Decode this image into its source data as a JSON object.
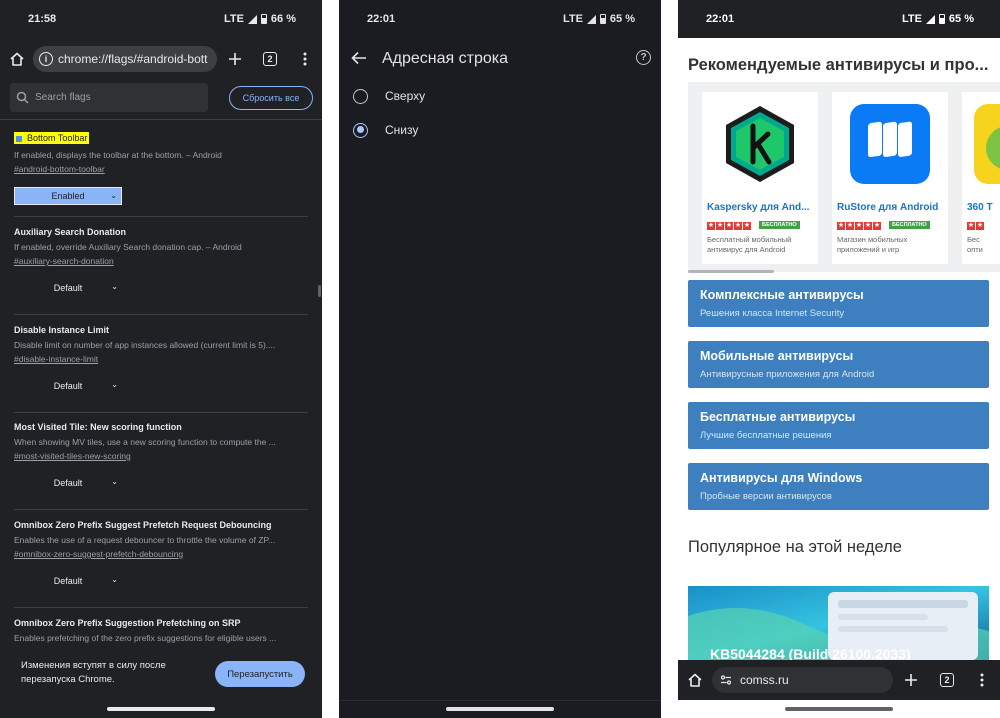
{
  "panel1": {
    "status": {
      "time": "21:58",
      "network": "LTE",
      "battery": "66 %"
    },
    "url": "chrome://flags/#android-bott",
    "tab_count": "2",
    "search_placeholder": "Search flags",
    "reset_label": "Сбросить все",
    "flags": [
      {
        "title": "Bottom Toolbar",
        "desc": "If enabled, displays the toolbar at the bottom. – Android",
        "link": "#android-bottom-toolbar",
        "value": "Enabled"
      },
      {
        "title": "Auxiliary Search Donation",
        "desc": "If enabled, override Auxiliary Search donation cap. – Android",
        "link": "#auxiliary-search-donation",
        "value": "Default"
      },
      {
        "title": "Disable Instance Limit",
        "desc": "Disable limit on number of app instances allowed (current limit is 5)....",
        "link": "#disable-instance-limit",
        "value": "Default"
      },
      {
        "title": "Most Visited Tile: New scoring function",
        "desc": "When showing MV tiles, use a new scoring function to compute the ...",
        "link": "#most-visited-tiles-new-scoring",
        "value": "Default"
      },
      {
        "title": "Omnibox Zero Prefix Suggest Prefetch Request Debouncing",
        "desc": "Enables the use of a request debouncer to throttle the volume of ZP...",
        "link": "#omnibox-zero-suggest-prefetch-debouncing",
        "value": "Default"
      },
      {
        "title": "Omnibox Zero Prefix Suggestion Prefetching on SRP",
        "desc": "Enables prefetching of the zero prefix suggestions for eligible users ..."
      }
    ],
    "snackbar_text": "Изменения вступят в силу после перезапуска Chrome.",
    "restart_label": "Перезапустить"
  },
  "panel2": {
    "status": {
      "time": "22:01",
      "network": "LTE",
      "battery": "65 %"
    },
    "title": "Адресная строка",
    "options": [
      {
        "label": "Сверху",
        "selected": false
      },
      {
        "label": "Снизу",
        "selected": true
      }
    ]
  },
  "panel3": {
    "status": {
      "time": "22:01",
      "network": "LTE",
      "battery": "65 %"
    },
    "section_title": "Рекомендуемые антивирусы и про...",
    "apps": [
      {
        "name": "Kaspersky для And...",
        "badge": "БЕСПЛАТНО",
        "desc": "Бесплатный мобильный антивирус для Android",
        "icon": "kaspersky-icon",
        "color": "#1a1a1a"
      },
      {
        "name": "RuStore для Android",
        "badge": "БЕСПЛАТНО",
        "desc": "Магазин мобильных приложений и игр",
        "icon": "rustore-icon",
        "color": "#0077ff"
      },
      {
        "name": "360 T",
        "badge": "",
        "desc": "Бес\nопти",
        "icon": "360-icon",
        "color": "#f5d400"
      }
    ],
    "categories": [
      {
        "title": "Комплексные антивирусы",
        "sub": "Решения класса Internet Security"
      },
      {
        "title": "Мобильные антивирусы",
        "sub": "Антивирусные приложения для Android"
      },
      {
        "title": "Бесплатные антивирусы",
        "sub": "Лучшие бесплатные решения"
      },
      {
        "title": "Антивирусы для Windows",
        "sub": "Пробные версии антивирусов"
      }
    ],
    "popular_title": "Популярное на этой неделе",
    "article_title": "KB5044284 (Build 26100.2033)",
    "url": "comss.ru",
    "tab_count": "2"
  }
}
